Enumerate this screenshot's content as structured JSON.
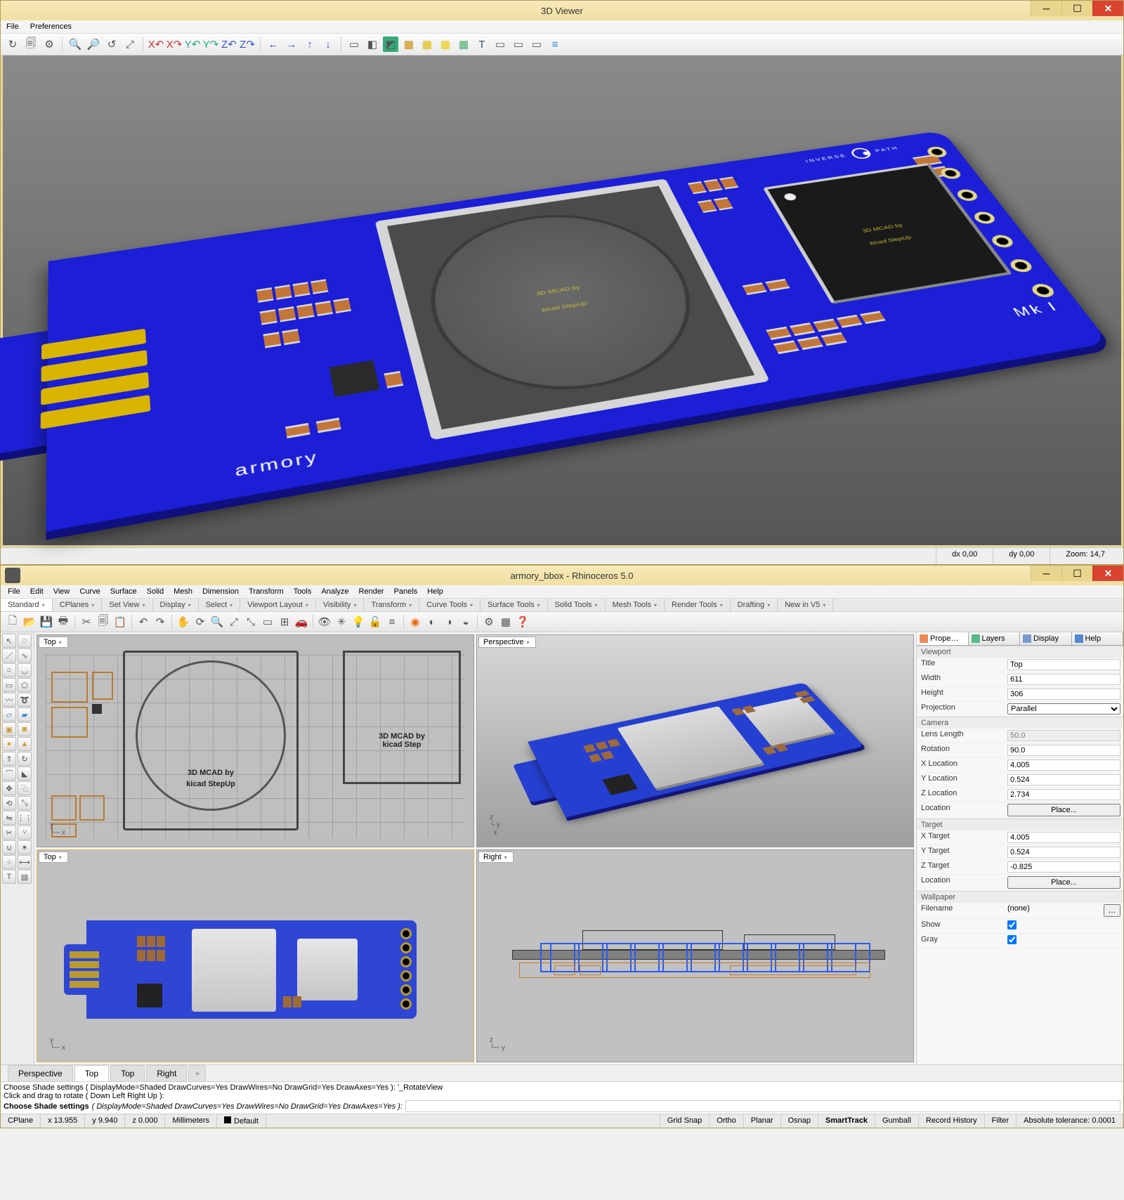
{
  "viewer": {
    "title": "3D Viewer",
    "menu": [
      "File",
      "Preferences"
    ],
    "status": {
      "dx": "dx 0,00",
      "dy": "dy 0,00",
      "zoom": "Zoom: 14,7"
    },
    "pcb": {
      "brand1": "INVERSE",
      "brand2": "PATH",
      "armory": "armory",
      "mk": "Mk I",
      "chip_label1": "3D MCAD by",
      "chip_label2": "kicad StepUp"
    }
  },
  "rhino": {
    "title": "armory_bbox - Rhinoceros 5.0",
    "menu": [
      "File",
      "Edit",
      "View",
      "Curve",
      "Surface",
      "Solid",
      "Mesh",
      "Dimension",
      "Transform",
      "Tools",
      "Analyze",
      "Render",
      "Panels",
      "Help"
    ],
    "ribbon_tabs": [
      "Standard",
      "CPlanes",
      "Set View",
      "Display",
      "Select",
      "Viewport Layout",
      "Visibility",
      "Transform",
      "Curve Tools",
      "Surface Tools",
      "Solid Tools",
      "Mesh Tools",
      "Render Tools",
      "Drafting",
      "New in V5"
    ],
    "viewports": {
      "top1": "Top",
      "persp": "Perspective",
      "top2": "Top",
      "right": "Right"
    },
    "viewport_tabs": [
      "Perspective",
      "Top",
      "Top",
      "Right"
    ],
    "right_panel": {
      "tabs": [
        "Prope…",
        "Layers",
        "Display",
        "Help"
      ],
      "sections": {
        "viewport_h": "Viewport",
        "title_k": "Title",
        "title_v": "Top",
        "width_k": "Width",
        "width_v": "611",
        "height_k": "Height",
        "height_v": "306",
        "proj_k": "Projection",
        "proj_v": "Parallel",
        "camera_h": "Camera",
        "lens_k": "Lens Length",
        "lens_v": "50.0",
        "rot_k": "Rotation",
        "rot_v": "90.0",
        "xloc_k": "X Location",
        "xloc_v": "4.005",
        "yloc_k": "Y Location",
        "yloc_v": "0.524",
        "zloc_k": "Z Location",
        "zloc_v": "2.734",
        "loc_k": "Location",
        "loc_btn": "Place...",
        "target_h": "Target",
        "xt_k": "X Target",
        "xt_v": "4.005",
        "yt_k": "Y Target",
        "yt_v": "0.524",
        "zt_k": "Z Target",
        "zt_v": "-0.825",
        "tloc_k": "Location",
        "tloc_btn": "Place...",
        "wall_h": "Wallpaper",
        "fn_k": "Filename",
        "fn_v": "(none)",
        "show_k": "Show",
        "gray_k": "Gray"
      }
    },
    "cmd": {
      "l1": "Choose Shade settings ( DisplayMode=Shaded  DrawCurves=Yes  DrawWires=No  DrawGrid=Yes  DrawAxes=Yes ): '_RotateView",
      "l2": "Click and drag to rotate ( Down  Left  Right  Up ):",
      "prompt_label": "Choose Shade settings",
      "prompt_opts": "( DisplayMode=Shaded  DrawCurves=Yes  DrawWires=No  DrawGrid=Yes  DrawAxes=Yes ):"
    },
    "status": {
      "cplane": "CPlane",
      "x": "x 13.955",
      "y": "y 9.940",
      "z": "z 0.000",
      "units": "Millimeters",
      "layer": "Default",
      "toggles": [
        "Grid Snap",
        "Ortho",
        "Planar",
        "Osnap",
        "SmartTrack",
        "Gumball",
        "Record History",
        "Filter"
      ],
      "on": "SmartTrack",
      "tol": "Absolute tolerance: 0.0001"
    },
    "wire_text": {
      "l1": "3D MCAD by",
      "l2": "kicad StepUp"
    }
  }
}
